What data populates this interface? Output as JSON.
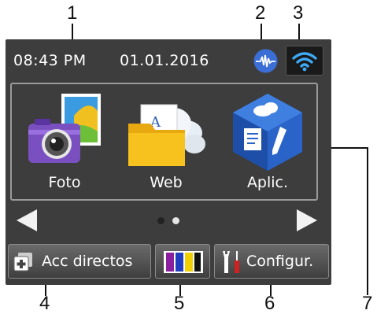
{
  "status_bar": {
    "time": "08:43 PM",
    "date": "01.01.2016",
    "wired_lan_icon": "wired-lan-icon",
    "wifi_icon": "wifi-icon"
  },
  "apps": [
    {
      "label": "Foto",
      "icon": "photo-camera-icon"
    },
    {
      "label": "Web",
      "icon": "web-folder-cloud-icon"
    },
    {
      "label": "Aplic.",
      "icon": "apps-cube-icon"
    }
  ],
  "pager": {
    "prev_icon": "arrow-left-icon",
    "next_icon": "arrow-right-icon",
    "pages": 2,
    "current_page": 1
  },
  "bottom_buttons": {
    "shortcuts_label": "Acc directos",
    "ink_icon": "ink-cartridges-icon",
    "settings_label": "Configur."
  },
  "ink_colors": [
    "#8a1fa0",
    "#1f3fc0",
    "#f0d000",
    "#111111"
  ],
  "callouts": [
    "1",
    "2",
    "3",
    "4",
    "5",
    "6",
    "7"
  ]
}
